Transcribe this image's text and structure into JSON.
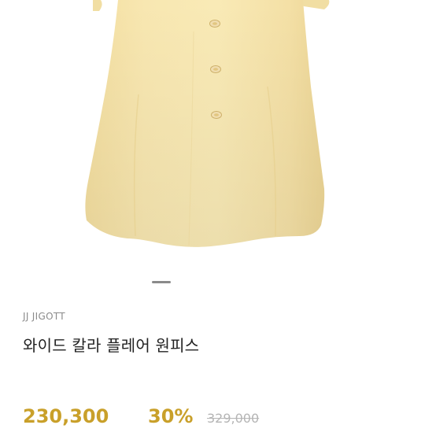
{
  "product": {
    "brand": "JJ JIGOTT",
    "name": "와이드 칼라 플레어 원피스",
    "sale_price": "230,300",
    "discount": "30%",
    "original_price": "329,000",
    "image_description": "yellow-flare-dress"
  },
  "gallery": {
    "pager_state": "page-indicator"
  },
  "colors": {
    "dress": "#f7e6ad",
    "accent_price": "#c9a02a",
    "muted": "#b5b5b5",
    "brand_text": "#8b8b8b",
    "title_text": "#222222"
  }
}
